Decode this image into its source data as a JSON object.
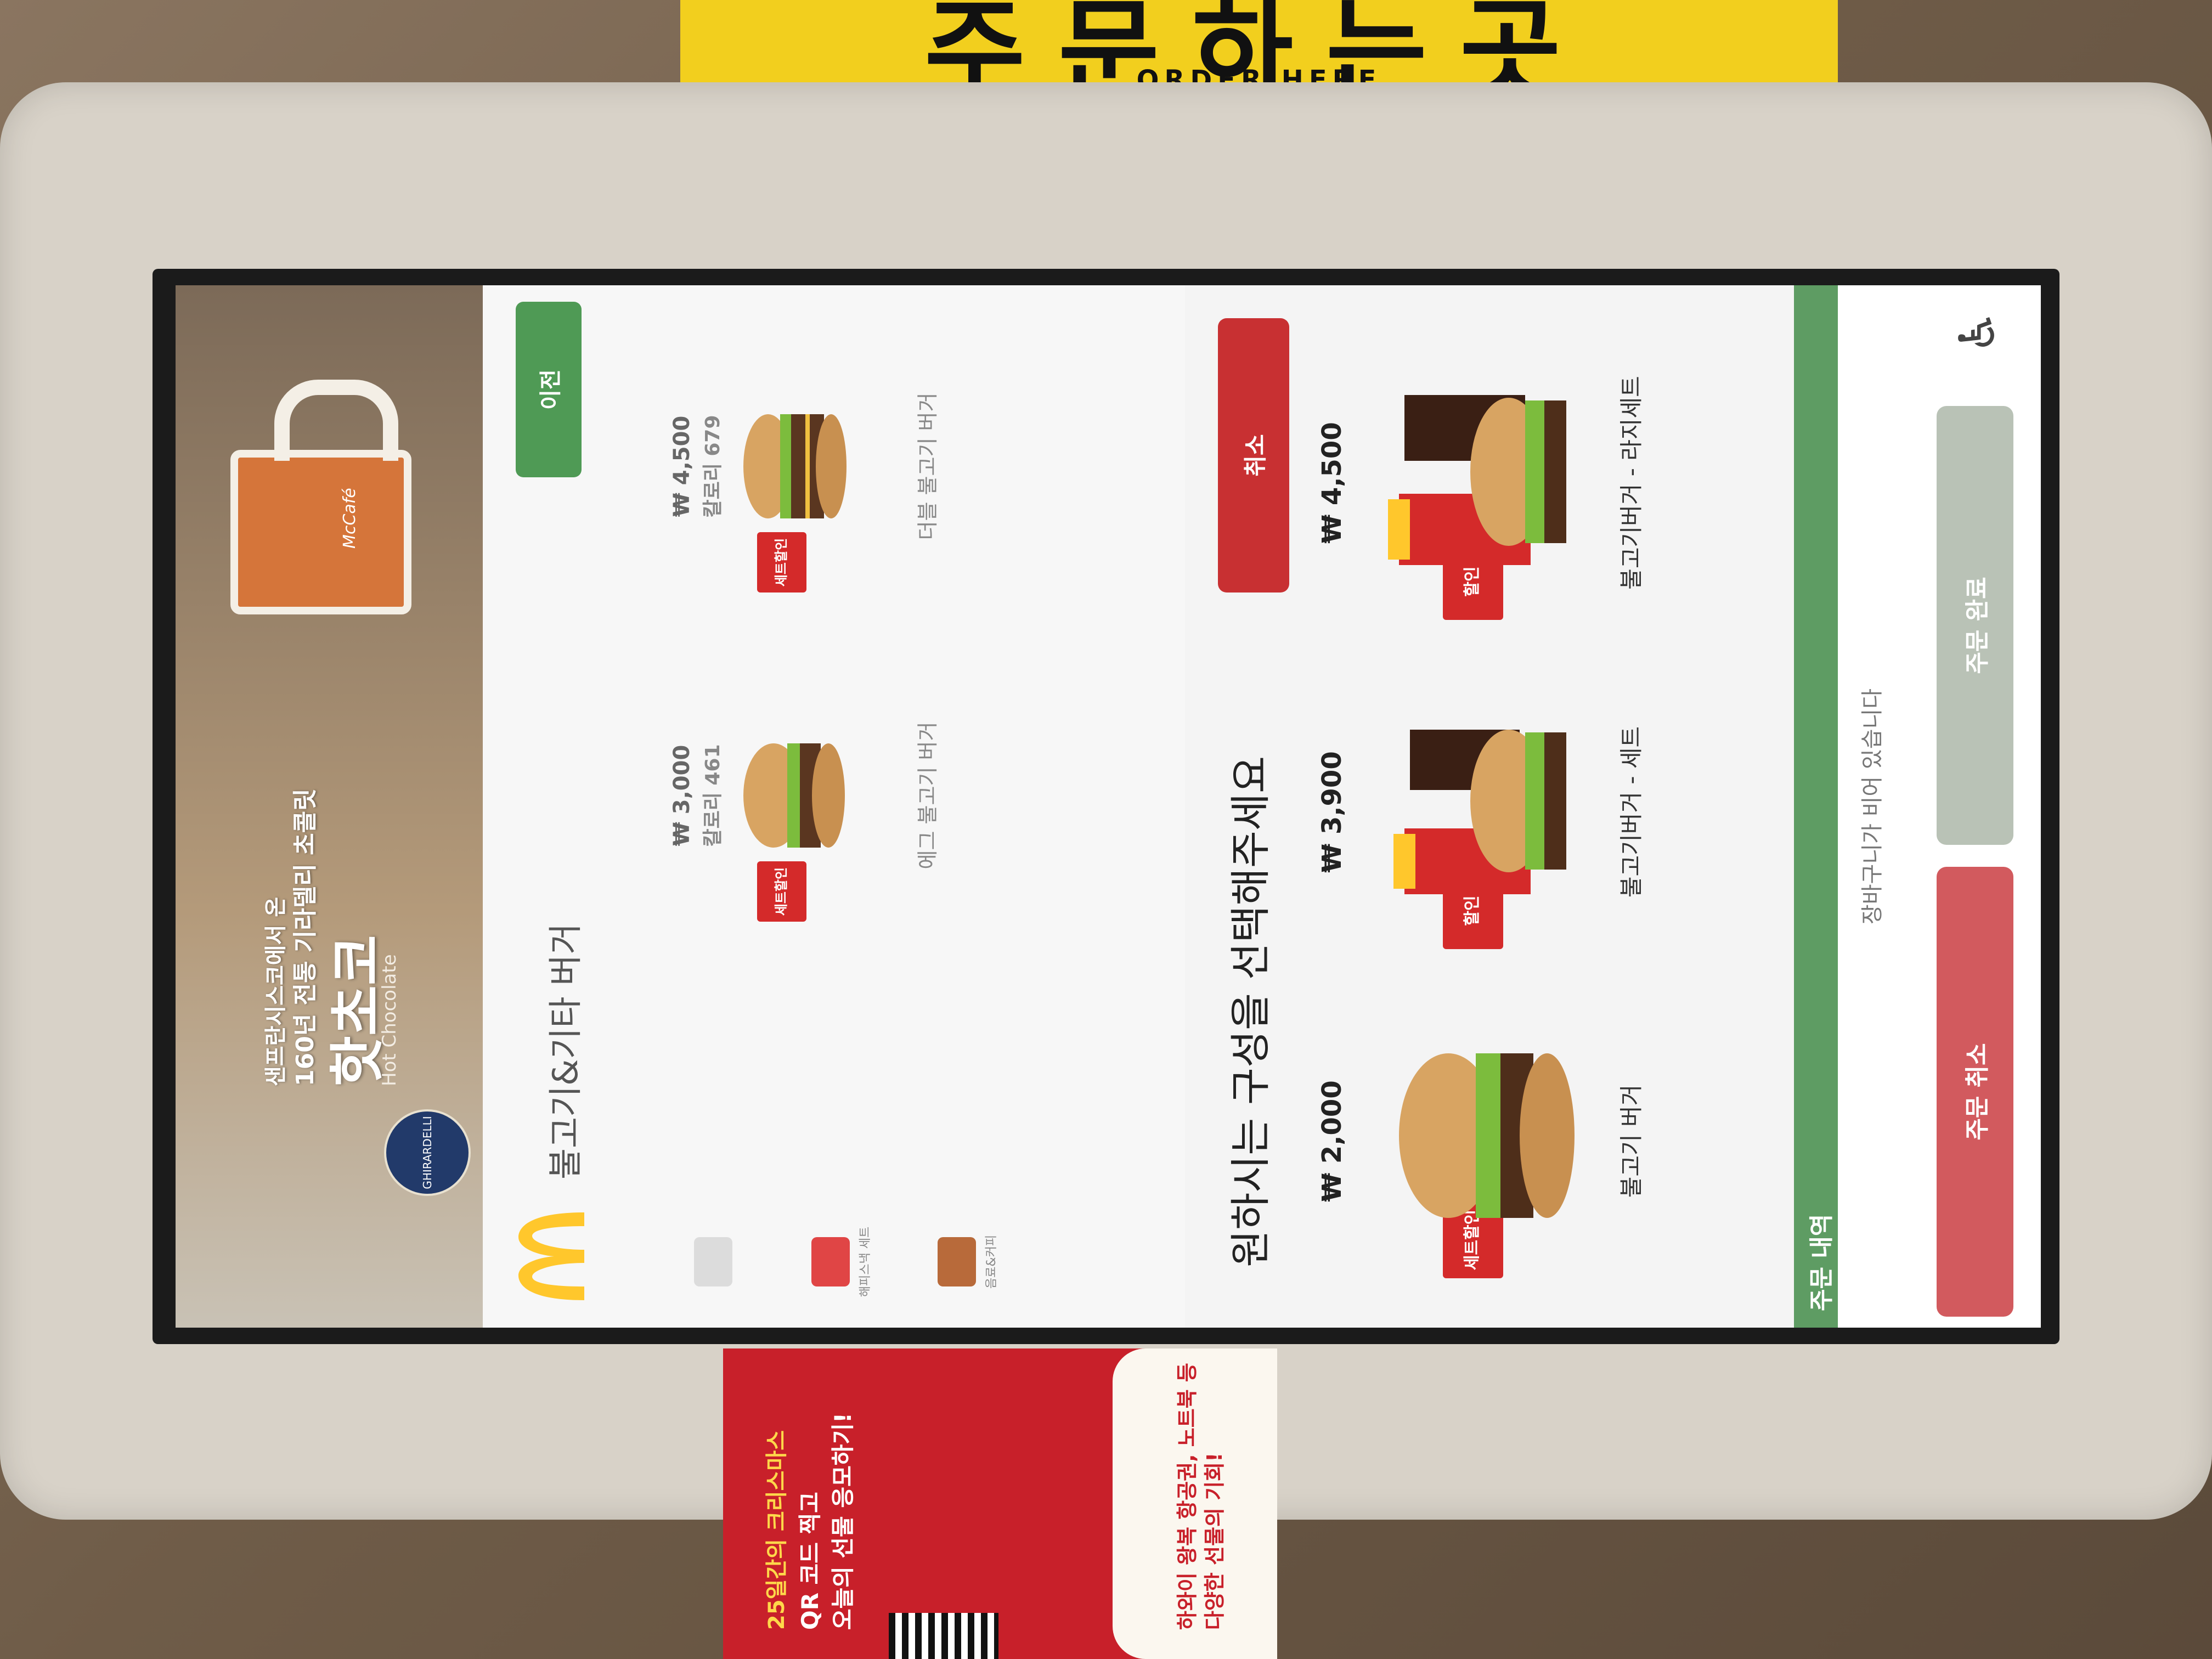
{
  "signage": {
    "top_sign_text": "주문하는곳",
    "top_sign_sub": "ORDER HERE"
  },
  "promo_poster": {
    "line1": "25일간의 크리스마스",
    "line2": "QR 코드 찍고",
    "line3": "오늘의 선물 응모하기!",
    "line4": "하와이 왕복 항공권, 노트북 등",
    "line5": "다양한 선물의 기회!"
  },
  "banner": {
    "line1": "샌프란시스코에서 온",
    "line2": "160년 전통 기라델리 초콜릿",
    "title": "핫초코",
    "subtitle": "Hot Chocolate",
    "brand_badge": "GHIRARDELLI",
    "mug_label": "McCafé"
  },
  "menu_page": {
    "category_title": "불고기&기타 버거",
    "back_label": "이전",
    "side_nav": [
      {
        "label": "",
        "color": "#dcdcdc"
      },
      {
        "label": "해피스낵 세트",
        "color": "#e04545"
      },
      {
        "label": "음료&커피",
        "color": "#b86a3a"
      }
    ],
    "items": [
      {
        "price": "₩ 3,000",
        "calories": "칼로리 461",
        "name": "에그 불고기 버거",
        "badge": "세트할인"
      },
      {
        "price": "₩ 4,500",
        "calories": "칼로리 679",
        "name": "더블 불고기 버거",
        "badge": "세트할인"
      }
    ]
  },
  "options": {
    "title": "원하시는 구성을 선택해주세요",
    "cancel_label": "취소",
    "cards": [
      {
        "price": "₩ 2,000",
        "name": "불고기 버거",
        "badge": "세트할인",
        "info_icon": "info-icon"
      },
      {
        "price": "₩ 3,900",
        "name": "불고기버거 - 세트",
        "badge": "할인",
        "info_icon": "info-icon"
      },
      {
        "price": "₩ 4,500",
        "name": "불고기버거 - 라지세트",
        "badge": "할인",
        "info_icon": "info-icon"
      }
    ]
  },
  "order": {
    "header": "주문 내역",
    "empty_text": "장바구니가 비어 있습니다",
    "cancel_label": "주문 취소",
    "complete_label": "주문 완료",
    "accessibility_icon": "wheelchair-icon"
  },
  "colors": {
    "mcd_yellow": "#ffc72c",
    "green": "#4f9a55",
    "red": "#c83032"
  }
}
